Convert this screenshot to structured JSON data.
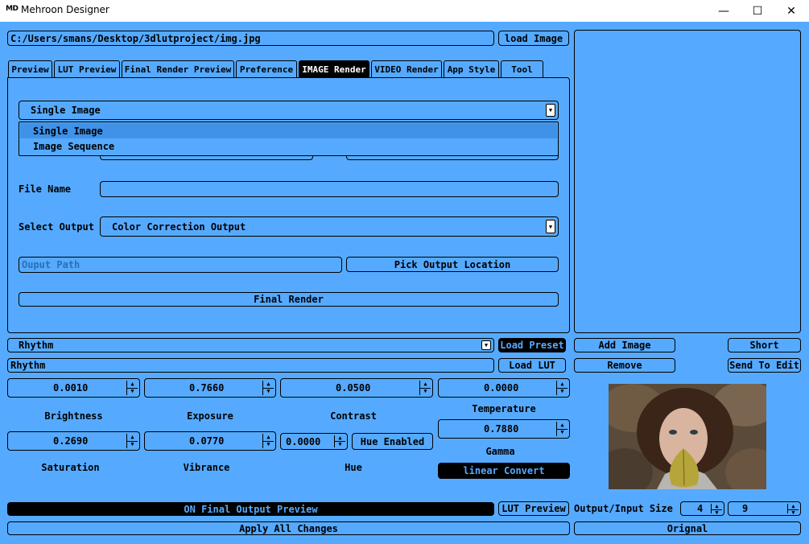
{
  "window": {
    "logo": "MD",
    "title": "Mehroon Designer",
    "minimize": "—",
    "maximize": "☐",
    "close": "✕"
  },
  "path_field": "C:/Users/smans/Desktop/3dlutproject/img.jpg",
  "load_image_label": "load Image",
  "tabs": [
    "Preview",
    "LUT Preview",
    "Final Render Preview",
    "Preference",
    "IMAGE Render",
    "VIDEO Render",
    "App Style",
    "Tool"
  ],
  "active_tab": "IMAGE Render",
  "render_panel": {
    "mode_select": "Single Image",
    "mode_options": [
      "Single Image",
      "Image Sequence"
    ],
    "file_name_label": "File Name",
    "file_name_value": "",
    "select_output_label": "Select Output",
    "select_output_value": "Color Correction Output",
    "output_path_placeholder": "Ouput Path",
    "pick_output_label": "Pick Output Location",
    "final_render_label": "Final Render"
  },
  "preset": {
    "select_value": "Rhythm",
    "load_preset_label": "Load Preset",
    "lut_name": "Rhythm",
    "load_lut_label": "Load LUT"
  },
  "side_buttons": {
    "add_image": "Add Image",
    "short": "Short",
    "remove": "Remove",
    "send_to_edit": "Send To Edit"
  },
  "adjustments": {
    "brightness": {
      "value": "0.0010",
      "label": "Brightness"
    },
    "exposure": {
      "value": "0.7660",
      "label": "Exposure"
    },
    "contrast": {
      "value": "0.0500",
      "label": "Contrast"
    },
    "temperature": {
      "value": "0.0000",
      "label": "Temperature"
    },
    "gamma": {
      "value": "0.7880",
      "label": "Gamma"
    },
    "saturation": {
      "value": "0.2690",
      "label": "Saturation"
    },
    "vibrance": {
      "value": "0.0770",
      "label": "Vibrance"
    },
    "hue": {
      "value": "0.0000",
      "label": "Hue"
    },
    "hue_enabled_label": "Hue Enabled",
    "linear_convert_label": "linear Convert"
  },
  "footer": {
    "final_output_preview": "ON Final Output Preview",
    "lut_preview": "LUT Preview",
    "output_input_size_label": "Output/Input Size",
    "size_a": "4",
    "size_b": "9",
    "apply_all": "Apply All Changes",
    "original": "Orignal"
  },
  "colors": {
    "background": "#55aaff",
    "accent_dark": "#000000",
    "dark_button_text": "#55aaff"
  },
  "icons": {
    "spin_up": "▲",
    "spin_down": "▼",
    "dropdown": "▼"
  }
}
